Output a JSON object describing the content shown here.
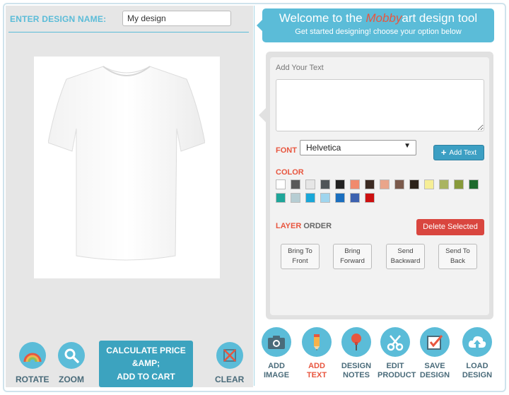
{
  "design_name": {
    "label": "ENTER DESIGN NAME:",
    "value": "My design"
  },
  "left_toolbar": {
    "rotate": "ROTATE",
    "zoom": "ZOOM",
    "calc_line1": "CALCULATE PRICE",
    "calc_line2": "&AMP;",
    "calc_line3": "ADD TO CART",
    "clear": "CLEAR"
  },
  "welcome": {
    "title_pre": "Welcome to the ",
    "title_brand": "Mobby",
    "title_post": "art design tool",
    "subtitle": "Get started designing! choose your option below"
  },
  "editor": {
    "add_text_label": "Add Your Text",
    "text_value": "",
    "font_label": "FONT",
    "font_selected": "Helvetica",
    "add_text_button": "Add Text",
    "color_label": "COLOR",
    "colors": [
      "#ffffff",
      "#5a5a5a",
      "#e6e6e6",
      "#505558",
      "#222222",
      "#f08a6d",
      "#3b2a22",
      "#e9a58a",
      "#7b5a4c",
      "#2b2219",
      "#f6ee96",
      "#a9b460",
      "#889a3a",
      "#1e6a2d",
      "#1fa69a",
      "#b6cdd3",
      "#1aa7d8",
      "#9fd5ee",
      "#1b6fbf",
      "#3d62b0",
      "#cc1010"
    ],
    "layer_label_1": "LAYER",
    "layer_label_2": " ORDER",
    "delete_button": "Delete Selected",
    "order_buttons": [
      {
        "l1": "Bring To",
        "l2": "Front"
      },
      {
        "l1": "Bring",
        "l2": "Forward"
      },
      {
        "l1": "Send",
        "l2": "Backward"
      },
      {
        "l1": "Send To",
        "l2": "Back"
      }
    ]
  },
  "right_toolbar": [
    {
      "l1": "ADD",
      "l2": "IMAGE",
      "icon": "camera-icon"
    },
    {
      "l1": "ADD",
      "l2": "TEXT",
      "icon": "pencil-icon"
    },
    {
      "l1": "DESIGN",
      "l2": "NOTES",
      "icon": "pushpin-icon"
    },
    {
      "l1": "EDIT",
      "l2": "PRODUCT",
      "icon": "scissors-icon"
    },
    {
      "l1": "SAVE",
      "l2": "DESIGN",
      "icon": "checkbox-icon"
    },
    {
      "l1": "LOAD",
      "l2": "DESIGN",
      "icon": "cloud-upload-icon"
    }
  ],
  "accent_colors": {
    "primary": "#5bbcd8",
    "brand": "#e8563f",
    "danger": "#d9463f"
  }
}
